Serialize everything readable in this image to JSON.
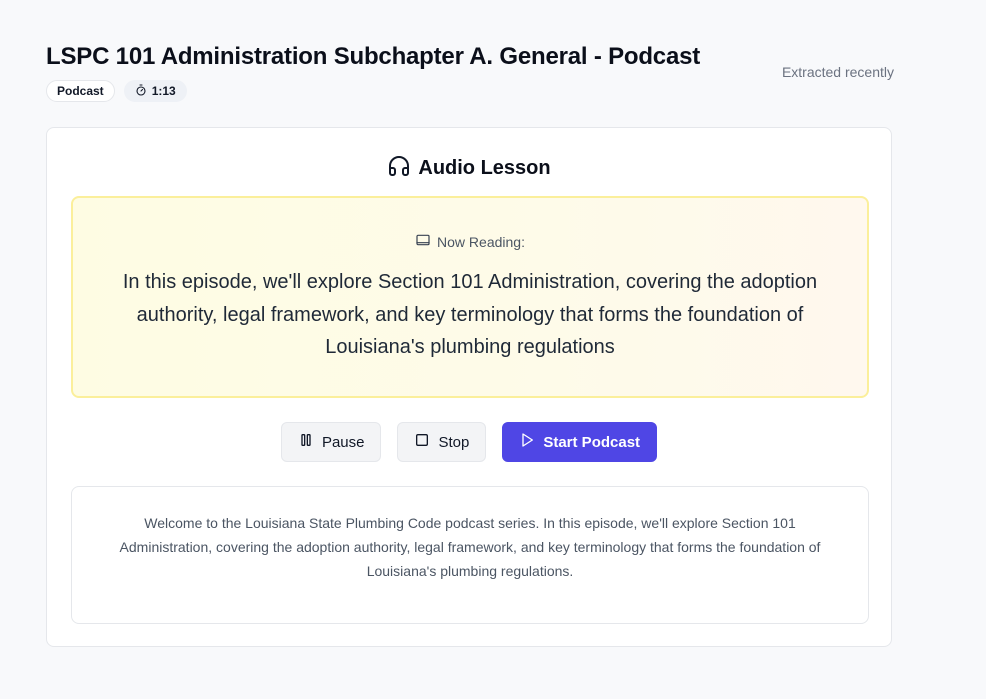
{
  "header": {
    "title": "LSPC 101 Administration Subchapter A. General - Podcast",
    "badges": {
      "type": "Podcast",
      "duration": "1:13"
    },
    "extracted": "Extracted recently"
  },
  "lesson": {
    "title": "Audio Lesson",
    "now_reading_label": "Now Reading:",
    "now_reading_text": "In this episode, we'll explore Section 101 Administration, covering the adoption authority, legal framework, and key terminology that forms the foundation of Louisiana's plumbing regulations"
  },
  "controls": {
    "pause_label": "Pause",
    "stop_label": "Stop",
    "start_label": "Start Podcast"
  },
  "transcript": {
    "text": "Welcome to the Louisiana State Plumbing Code podcast series. In this episode, we'll explore Section 101 Administration, covering the adoption authority, legal framework, and key terminology that forms the foundation of Louisiana's plumbing regulations."
  },
  "icons": {
    "duration": "timer-icon",
    "lesson": "headphones-icon",
    "reading": "book-icon",
    "pause": "pause-icon",
    "stop": "stop-icon",
    "start": "play-icon"
  },
  "colors": {
    "accent": "#4f46e5",
    "reading_border": "#fbef9b",
    "reading_background": "#fefce3"
  }
}
